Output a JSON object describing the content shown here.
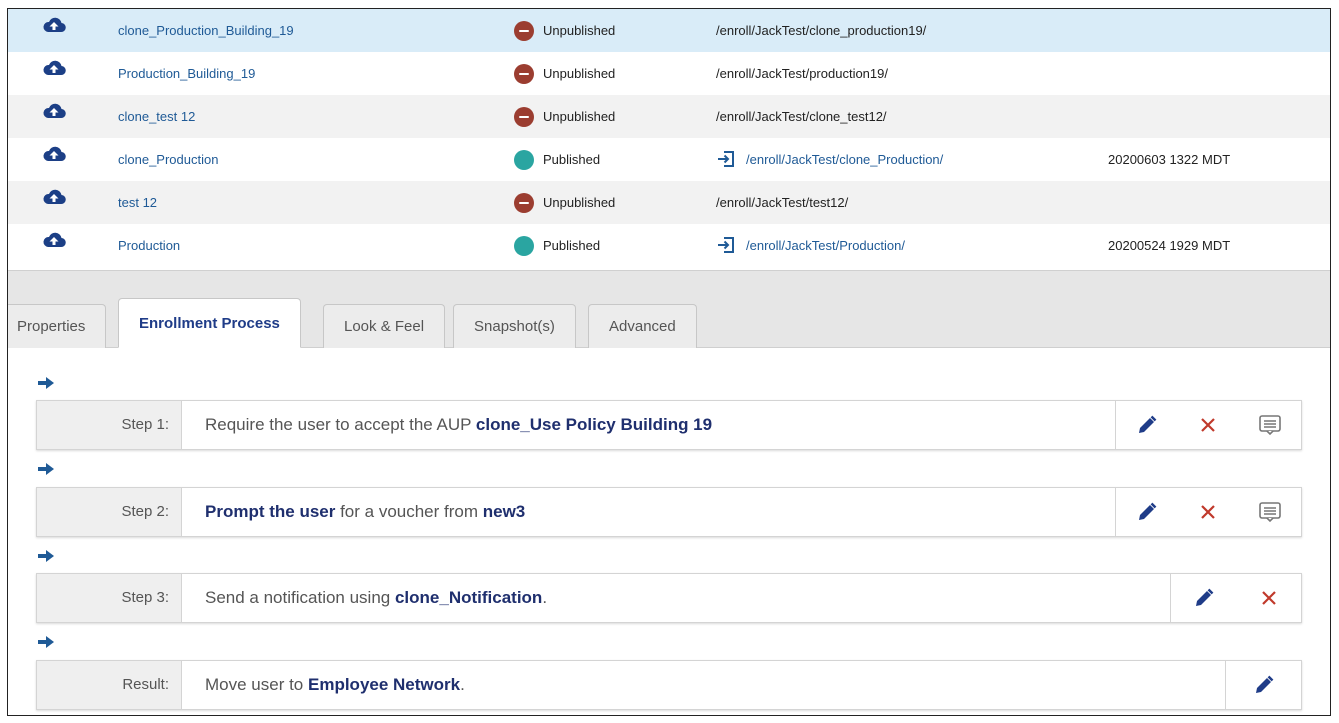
{
  "table": {
    "rows": [
      {
        "name": "clone_Production_Building_19",
        "status": "Unpublished",
        "path": "/enroll/JackTest/clone_production19/",
        "date": ""
      },
      {
        "name": "Production_Building_19",
        "status": "Unpublished",
        "path": "/enroll/JackTest/production19/",
        "date": ""
      },
      {
        "name": "clone_test 12",
        "status": "Unpublished",
        "path": "/enroll/JackTest/clone_test12/",
        "date": ""
      },
      {
        "name": "clone_Production",
        "status": "Published",
        "path": "/enroll/JackTest/clone_Production/",
        "date": "20200603 1322 MDT"
      },
      {
        "name": "test 12",
        "status": "Unpublished",
        "path": "/enroll/JackTest/test12/",
        "date": ""
      },
      {
        "name": "Production",
        "status": "Published",
        "path": "/enroll/JackTest/Production/",
        "date": "20200524 1929 MDT"
      }
    ]
  },
  "tabs": [
    "Properties",
    "Enrollment Process",
    "Look & Feel",
    "Snapshot(s)",
    "Advanced"
  ],
  "steps": [
    {
      "label": "Step 1:",
      "parts": [
        {
          "t": "Require the user to accept the AUP ",
          "b": false
        },
        {
          "t": "clone_Use Policy Building 19",
          "b": true
        }
      ]
    },
    {
      "label": "Step 2:",
      "parts": [
        {
          "t": "Prompt the user",
          "b": true
        },
        {
          "t": " for a voucher from ",
          "b": false
        },
        {
          "t": "new3",
          "b": true
        }
      ]
    },
    {
      "label": "Step 3:",
      "parts": [
        {
          "t": "Send a notification using ",
          "b": false
        },
        {
          "t": "clone_Notification",
          "b": true
        },
        {
          "t": ".",
          "b": false
        }
      ]
    },
    {
      "label": "Result:",
      "parts": [
        {
          "t": "Move user to ",
          "b": false
        },
        {
          "t": "Employee Network",
          "b": true
        },
        {
          "t": ".",
          "b": false
        }
      ]
    }
  ],
  "colors": {
    "accent": "#1f3c88",
    "unpublished": "#9b3d30",
    "published": "#2aa5a1",
    "link": "#1f5a96"
  },
  "icons": {
    "row": "cloud-upload-icon",
    "step_arrow": "arrow-right-icon",
    "edit": "pencil-icon",
    "delete": "close-icon",
    "message": "message-icon",
    "path_link": "enter-link-icon"
  }
}
